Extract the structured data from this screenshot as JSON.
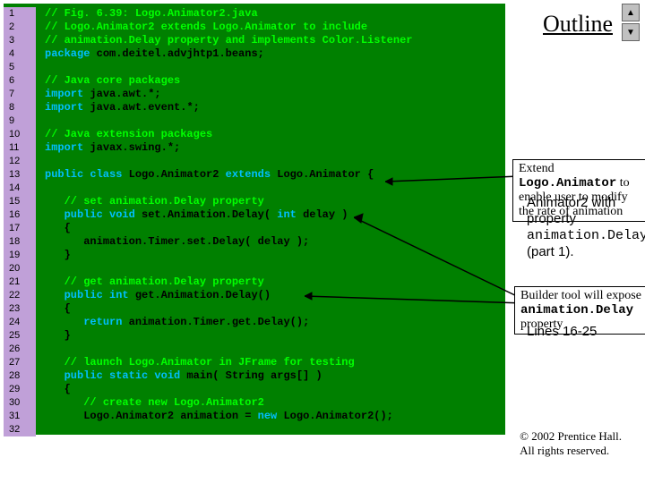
{
  "outline": "Outline",
  "lines": [
    {
      "n": "1",
      "cm": "// Fig. 6.39: Logo.Animator2.java"
    },
    {
      "n": "2",
      "cm": "// Logo.Animator2 extends Logo.Animator to include"
    },
    {
      "n": "3",
      "cm": "// animation.Delay property and implements Color.Listener"
    },
    {
      "n": "4",
      "kw": "package",
      "pl": " com.deitel.advjhtp1.beans;"
    },
    {
      "n": "5"
    },
    {
      "n": "6",
      "cm": "// Java core packages"
    },
    {
      "n": "7",
      "kw": "import",
      "pl": " java.awt.*;"
    },
    {
      "n": "8",
      "kw": "import",
      "pl": " java.awt.event.*;"
    },
    {
      "n": "9"
    },
    {
      "n": "10",
      "cm": "// Java extension packages"
    },
    {
      "n": "11",
      "kw": "import",
      "pl": " javax.swing.*;"
    },
    {
      "n": "12"
    },
    {
      "n": "13",
      "kw": "public class",
      "pl": " Logo.Animator2 ",
      "kw2": "extends",
      "pl2": " Logo.Animator {"
    },
    {
      "n": "14"
    },
    {
      "n": "15",
      "ind": "   ",
      "cm": "// set animation.Delay property"
    },
    {
      "n": "16",
      "ind": "   ",
      "kw": "public void",
      "pl": " set.Animation.Delay( ",
      "kw2": "int",
      "pl2": " delay )"
    },
    {
      "n": "17",
      "ind": "   ",
      "pl": "{"
    },
    {
      "n": "18",
      "ind": "      ",
      "pl": "animation.Timer.set.Delay( delay );"
    },
    {
      "n": "19",
      "ind": "   ",
      "pl": "}"
    },
    {
      "n": "20"
    },
    {
      "n": "21",
      "ind": "   ",
      "cm": "// get animation.Delay property"
    },
    {
      "n": "22",
      "ind": "   ",
      "kw": "public int",
      "pl": " get.Animation.Delay()"
    },
    {
      "n": "23",
      "ind": "   ",
      "pl": "{"
    },
    {
      "n": "24",
      "ind": "      ",
      "kw": "return",
      "pl": " animation.Timer.get.Delay();"
    },
    {
      "n": "25",
      "ind": "   ",
      "pl": "}"
    },
    {
      "n": "26"
    },
    {
      "n": "27",
      "ind": "   ",
      "cm": "// launch Logo.Animator in JFrame for testing"
    },
    {
      "n": "28",
      "ind": "   ",
      "kw": "public static void",
      "pl": " main( String args[] )"
    },
    {
      "n": "29",
      "ind": "   ",
      "pl": "{"
    },
    {
      "n": "30",
      "ind": "      ",
      "cm": "// create new Logo.Animator2"
    },
    {
      "n": "31",
      "ind": "      ",
      "pl": "Logo.Animator2 animation = ",
      "kw": "new",
      "pl2": " Logo.Animator2();"
    },
    {
      "n": "32"
    }
  ],
  "callout1_a": "Extend ",
  "callout1_m": "Logo.Animator",
  "callout1_b": " to enable user to modify the rate of animation",
  "callout2_a": "Builder tool will expose ",
  "callout2_m": "animation.Delay",
  "callout2_b": " property",
  "side1": "Animator2 with property",
  "side1m": "animation.Delay",
  "side1b": "(part 1).",
  "side2": "Lines 16-25",
  "footer1": "© 2002 Prentice Hall.",
  "footer2": "All rights reserved."
}
